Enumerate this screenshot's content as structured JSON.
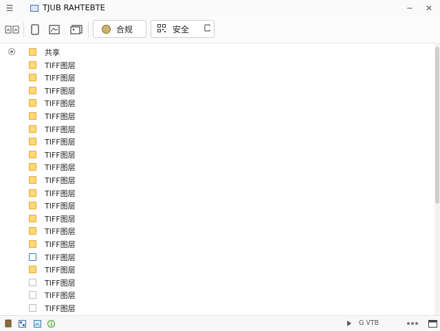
{
  "window": {
    "title": "TJUB RAHTEBTE",
    "minimize_glyph": "─",
    "close_glyph": "✕"
  },
  "toolbar": {
    "buttons": [
      {
        "label": "合规",
        "icon": "coin-icon"
      },
      {
        "label": "安全",
        "icon": "qr-icon"
      }
    ]
  },
  "tree": {
    "root_label": "共享",
    "items": [
      {
        "label": "TIFF图层",
        "folder": "yellow"
      },
      {
        "label": "TIFF图层",
        "folder": "yellow"
      },
      {
        "label": "TIFF图层",
        "folder": "yellow"
      },
      {
        "label": "TIFF图层",
        "folder": "yellow"
      },
      {
        "label": "TIFF图层",
        "folder": "yellow"
      },
      {
        "label": "TIFF图层",
        "folder": "yellow"
      },
      {
        "label": "TIFF图层",
        "folder": "yellow"
      },
      {
        "label": "TIFF图层",
        "folder": "yellow"
      },
      {
        "label": "TIFF图层",
        "folder": "yellow"
      },
      {
        "label": "TIFF图层",
        "folder": "yellow"
      },
      {
        "label": "TIFF图层",
        "folder": "yellow"
      },
      {
        "label": "TIFF图层",
        "folder": "yellow"
      },
      {
        "label": "TIFF图层",
        "folder": "yellow"
      },
      {
        "label": "TIFF图层",
        "folder": "yellow"
      },
      {
        "label": "TIFF图层",
        "folder": "yellow"
      },
      {
        "label": "TIFF图层",
        "folder": "blue"
      },
      {
        "label": "TIFF图层",
        "folder": "yellow"
      },
      {
        "label": "TIFF图层",
        "folder": "empty"
      },
      {
        "label": "TIFF图层",
        "folder": "empty"
      },
      {
        "label": "TIFF图层",
        "folder": "empty"
      }
    ]
  },
  "statusbar": {
    "text": "G VTB"
  },
  "colors": {
    "folder_yellow": "#ffd877",
    "folder_blue_border": "#2f78c4",
    "accent": "#3a6fb0"
  }
}
